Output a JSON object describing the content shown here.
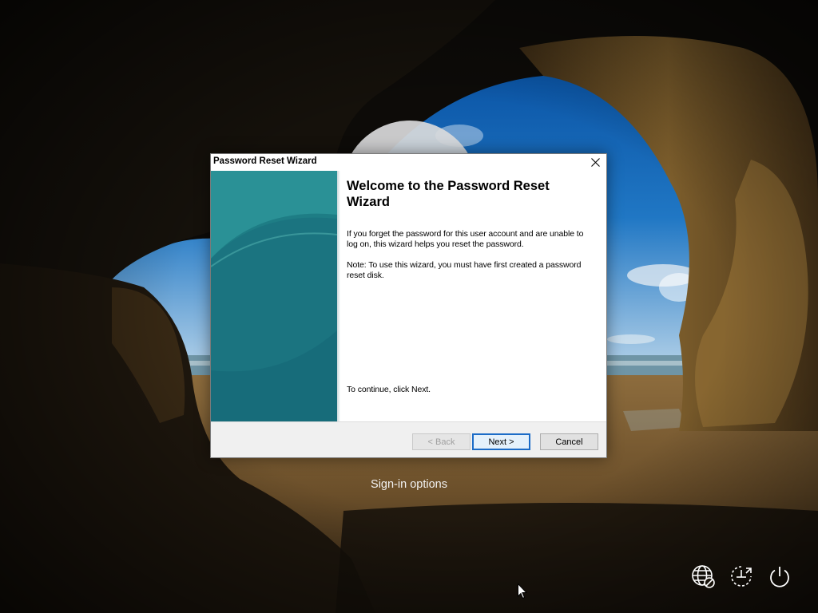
{
  "dialog": {
    "title": "Password Reset Wizard",
    "heading": "Welcome to the Password Reset Wizard",
    "description": "If you forget the password for this user account and are unable to log on, this wizard helps you reset the password.",
    "note": "Note: To use this wizard, you must have first created a password reset disk.",
    "instruction": "To continue, click Next.",
    "buttons": {
      "back": "< Back",
      "next": "Next >",
      "cancel": "Cancel"
    },
    "back_enabled": false,
    "default_button": "next"
  },
  "lock_screen": {
    "signin_options": "Sign-in options",
    "icons": [
      "network-icon",
      "ease-of-access-icon",
      "power-icon"
    ]
  },
  "colors": {
    "side_panel": "#1f7f86",
    "default_button_border": "#1c6cc7",
    "dialog_footer": "#f0f0f0"
  }
}
